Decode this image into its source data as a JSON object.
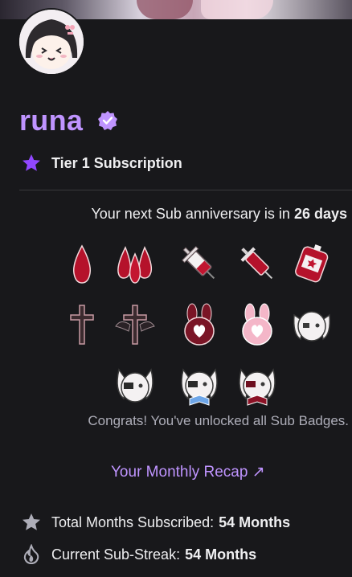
{
  "channel": {
    "name": "runa"
  },
  "subscription": {
    "tier_label": "Tier 1 Subscription"
  },
  "anniversary": {
    "prefix": "Your next Sub anniversary is in",
    "value": "26 days"
  },
  "badges": [
    {
      "icon": "blood-drop-icon"
    },
    {
      "icon": "triple-blood-drop-icon"
    },
    {
      "icon": "syringe-icon"
    },
    {
      "icon": "syringe-red-icon"
    },
    {
      "icon": "blood-bag-icon"
    },
    {
      "icon": "cross-icon"
    },
    {
      "icon": "winged-cross-icon"
    },
    {
      "icon": "dark-bunny-heart-icon"
    },
    {
      "icon": "pink-bunny-heart-icon"
    },
    {
      "icon": "white-bunny-face-icon"
    },
    {
      "icon": "bunny-eyepatch-icon"
    },
    {
      "icon": "bunny-blue-bow-icon"
    },
    {
      "icon": "bunny-red-bow-icon"
    }
  ],
  "congrats_text": "Congrats! You've unlocked all Sub Badges.",
  "recap_link": "Your Monthly Recap ↗",
  "stats": {
    "total_label": "Total Months Subscribed:",
    "total_value": "54 Months",
    "streak_label": "Current Sub-Streak:",
    "streak_value": "54 Months"
  },
  "colors": {
    "accent": "#bf94ff",
    "background": "#18181b",
    "text": "#efeff1",
    "muted": "#adadb8"
  }
}
